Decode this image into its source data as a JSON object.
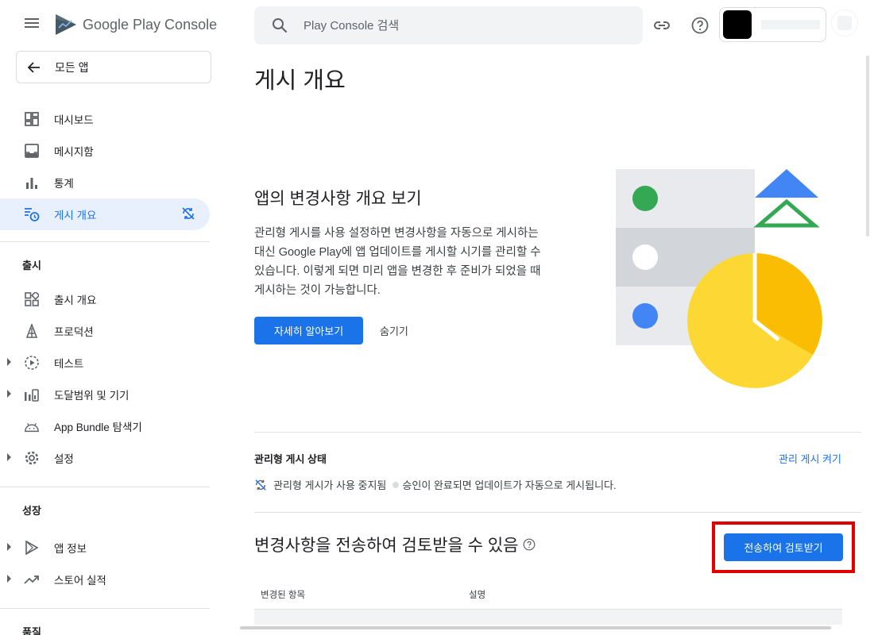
{
  "app": {
    "logo_text": "Google Play Console"
  },
  "sidebar": {
    "back_label": "모든 앱",
    "top_items": [
      {
        "label": "대시보드",
        "icon": "dashboard-icon"
      },
      {
        "label": "메시지함",
        "icon": "inbox-icon"
      },
      {
        "label": "통계",
        "icon": "bar-chart-icon"
      },
      {
        "label": "게시 개요",
        "icon": "publishing-overview-icon",
        "active": true
      }
    ],
    "release_section": "출시",
    "release_items": [
      {
        "label": "출시 개요",
        "icon": "release-overview-icon"
      },
      {
        "label": "프로덕션",
        "icon": "production-icon"
      },
      {
        "label": "테스트",
        "icon": "testing-icon",
        "expandable": true
      },
      {
        "label": "도달범위 및 기기",
        "icon": "reach-devices-icon",
        "expandable": true
      },
      {
        "label": "App Bundle 탐색기",
        "icon": "android-icon"
      },
      {
        "label": "설정",
        "icon": "gear-icon",
        "expandable": true
      }
    ],
    "grow_section": "성장",
    "grow_items": [
      {
        "label": "앱 정보",
        "icon": "play-icon",
        "expandable": true
      },
      {
        "label": "스토어 실적",
        "icon": "trending-up-icon",
        "expandable": true
      }
    ],
    "next_section": "품질"
  },
  "search": {
    "placeholder": "Play Console 검색"
  },
  "main": {
    "page_title": "게시 개요",
    "hero": {
      "title": "앱의 변경사항 개요 보기",
      "description": "관리형 게시를 사용 설정하면 변경사항을 자동으로 게시하는 대신 Google Play에 앱 업데이트를 게시할 시기를 관리할 수 있습니다. 이렇게 되면 미리 앱을 변경한 후 준비가 되었을 때 게시하는 것이 가능합니다.",
      "learn_more": "자세히 알아보기",
      "hide": "숨기기"
    },
    "managed_publishing": {
      "title": "관리형 게시 상태",
      "action": "관리 게시 켜기",
      "status_text": "관리형 게시가 사용 중지됨",
      "status_detail": "승인이 완료되면 업데이트가 자동으로 게시됩니다."
    },
    "send_review": {
      "title": "변경사항을 전송하여 검토받을 수 있음",
      "button": "전송하여 검토받기",
      "columns": [
        "변경된 항목",
        "설명"
      ]
    }
  },
  "colors": {
    "accent": "#1a73e8",
    "highlight": "#e00000",
    "active_bg": "#e8f0fe"
  }
}
